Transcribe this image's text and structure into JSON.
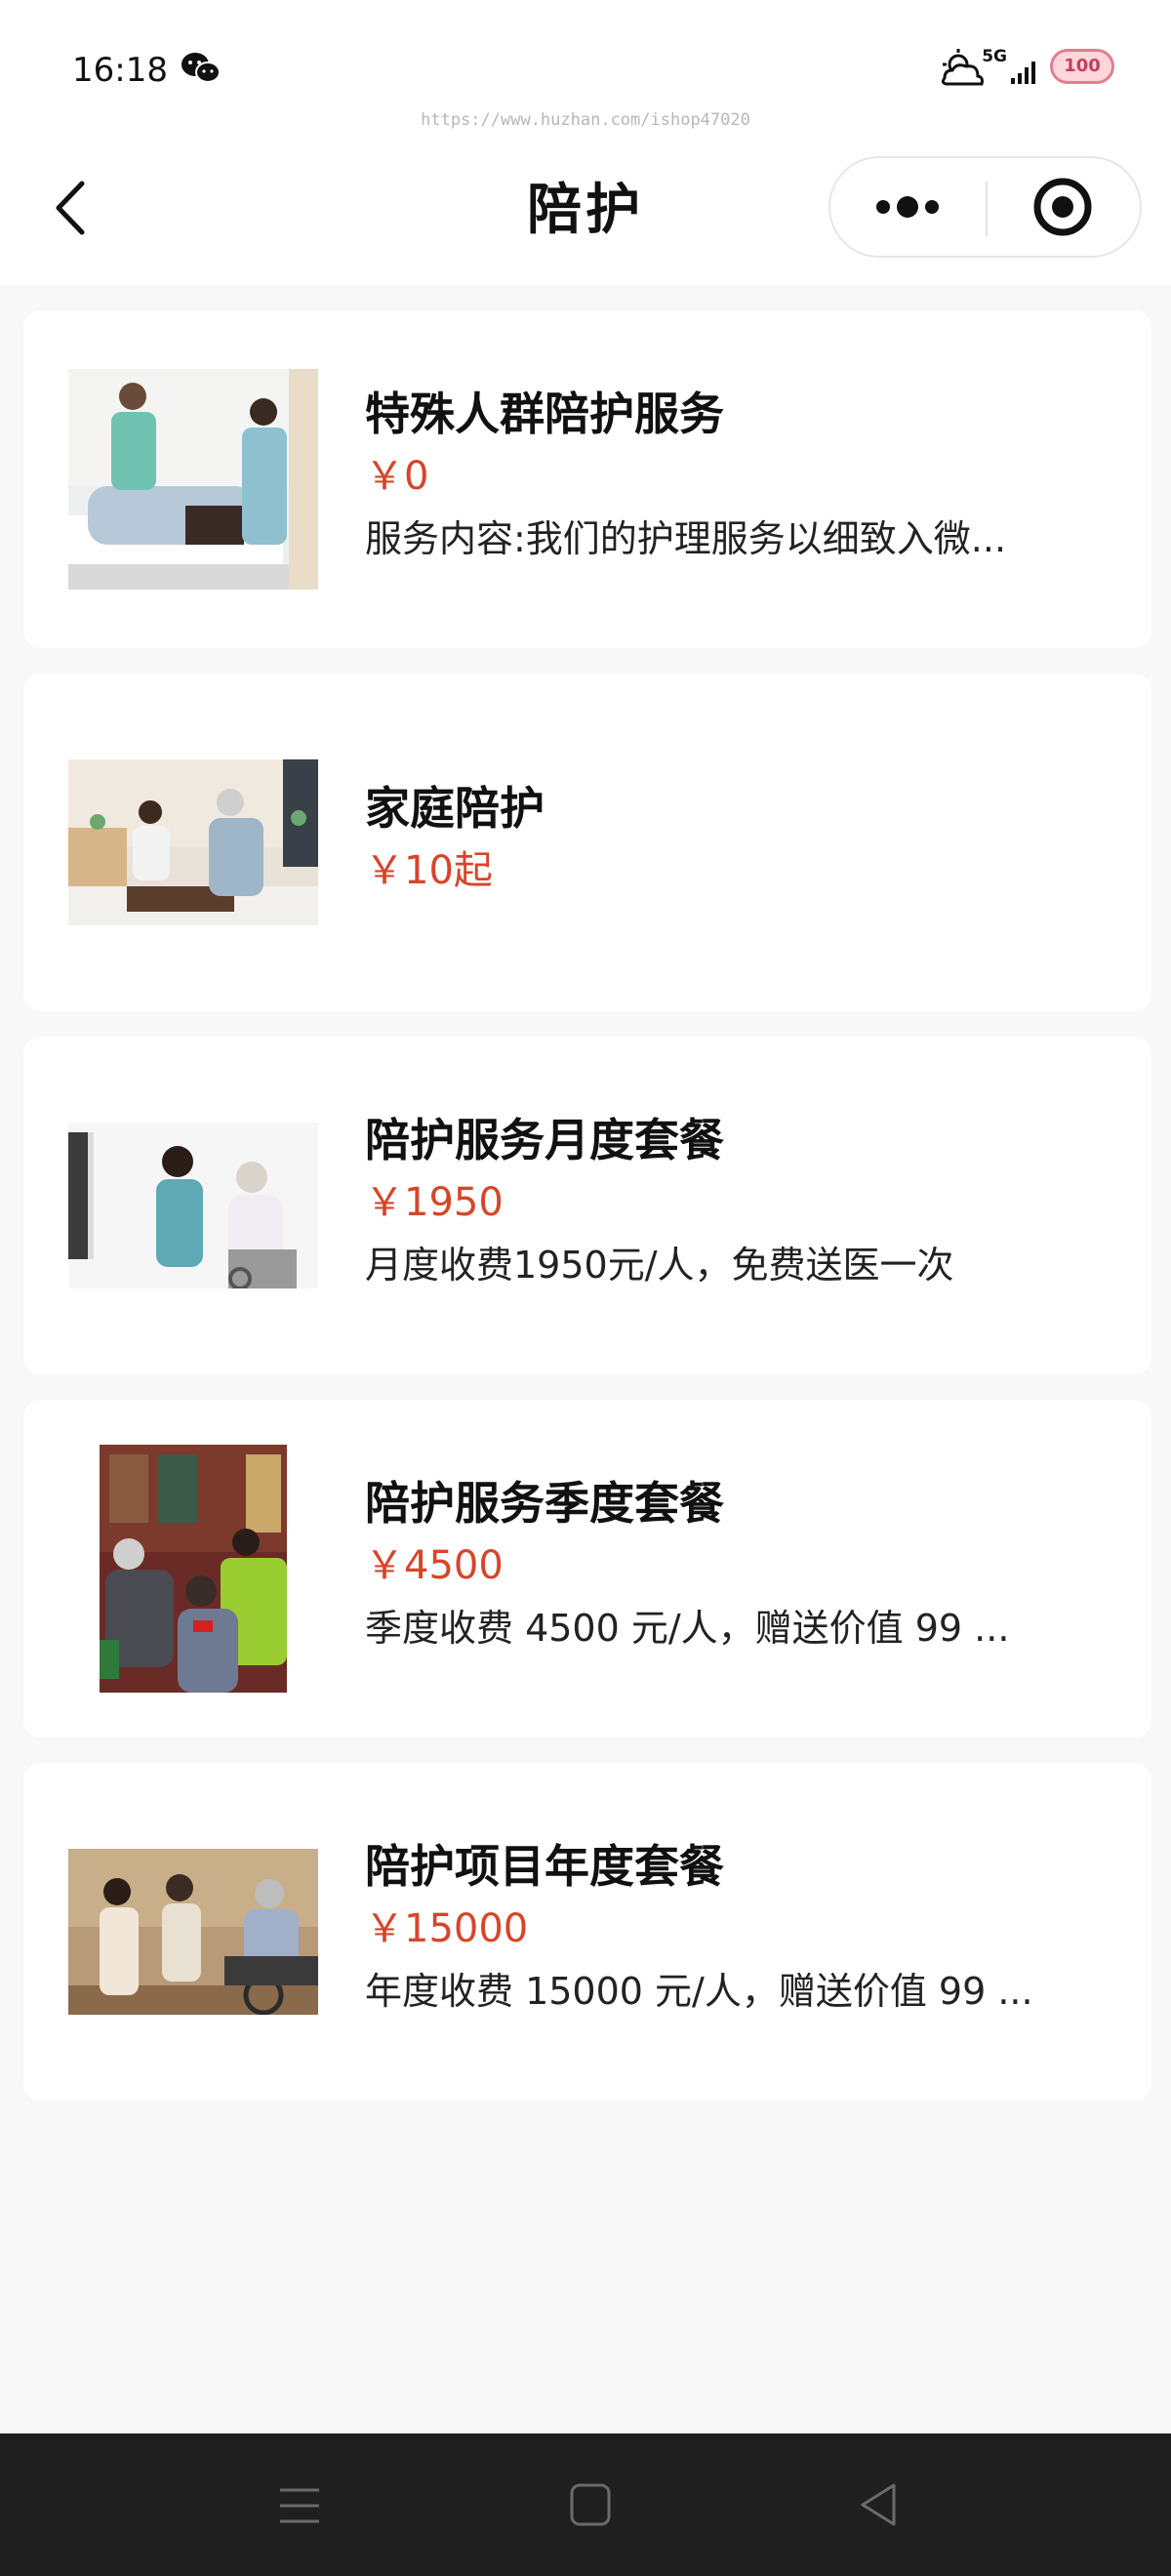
{
  "status": {
    "time": "16:18",
    "url": "https://www.huzhan.com/ishop47020",
    "network": "5G",
    "battery": "100"
  },
  "nav": {
    "title": "陪护"
  },
  "services": [
    {
      "title": "特殊人群陪护服务",
      "price": "￥0",
      "desc": "服务内容:我们的护理服务以细致入微..."
    },
    {
      "title": "家庭陪护",
      "price": "￥10起",
      "desc": ""
    },
    {
      "title": "陪护服务月度套餐",
      "price": "￥1950",
      "desc": "月度收费1950元/人，免费送医一次"
    },
    {
      "title": "陪护服务季度套餐",
      "price": "￥4500",
      "desc": "季度收费 4500 元/人，赠送价值 99 ..."
    },
    {
      "title": "陪护项目年度套餐",
      "price": "￥15000",
      "desc": "年度收费 15000 元/人，赠送价值 99 ..."
    }
  ],
  "colors": {
    "price": "#d6452a",
    "page_bg": "#f8f8f8",
    "sysnav_bg": "#1f1f1f"
  }
}
